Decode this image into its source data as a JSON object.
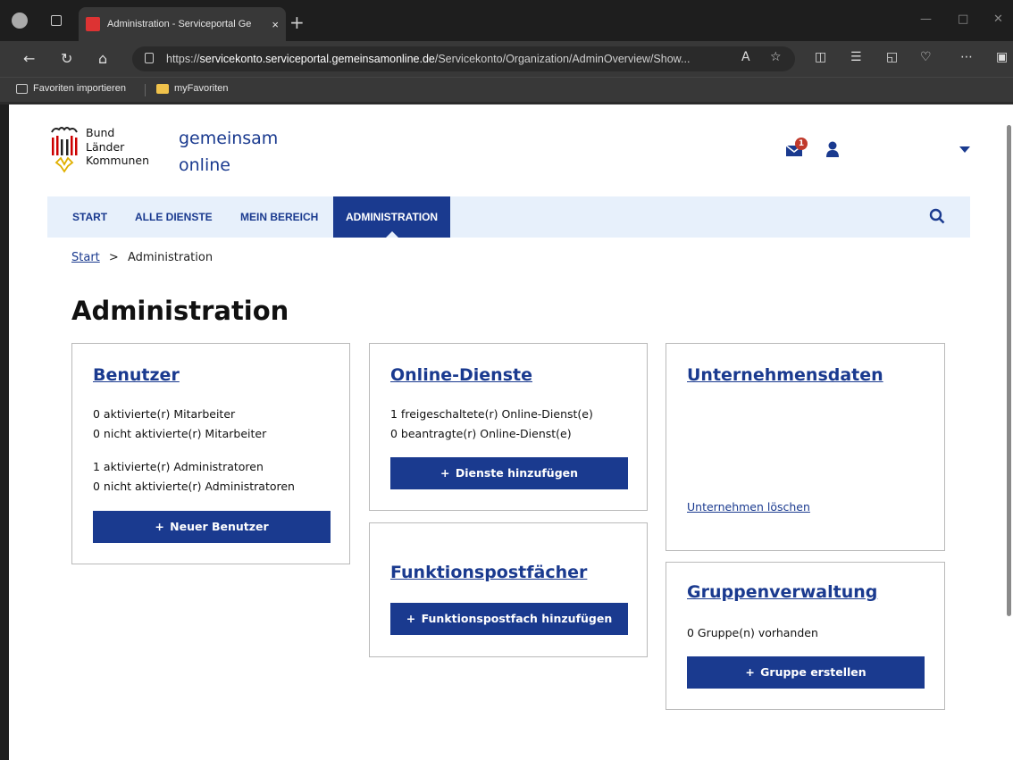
{
  "browser": {
    "tab_title": "Administration - Serviceportal Ge",
    "tab_close": "×",
    "new_tab": "+",
    "url_prefix": "https://",
    "url_host": "servicekonto.serviceportal.gemeinsamonline.de",
    "url_path": "/Servicekonto/Organization/AdminOverview/Show...",
    "favorites": [
      {
        "label": "Favoriten importieren",
        "icon": "import-icon"
      },
      {
        "label": "myFavoriten",
        "icon": "folder-icon"
      }
    ]
  },
  "logo": {
    "line1": "Bund",
    "line2": "Länder",
    "line3": "Kommunen",
    "brand_line1": "gemeinsam",
    "brand_line2": "online"
  },
  "header": {
    "mail_badge": "1"
  },
  "nav": {
    "items": [
      "START",
      "ALLE DIENSTE",
      "MEIN BEREICH",
      "ADMINISTRATION"
    ],
    "active_index": 3
  },
  "breadcrumb": {
    "start": "Start",
    "separator": ">",
    "current": "Administration"
  },
  "page_title": "Administration",
  "cards": {
    "benutzer": {
      "title": "Benutzer",
      "lines": [
        "0 aktivierte(r) Mitarbeiter",
        "0 nicht aktivierte(r) Mitarbeiter",
        "1 aktivierte(r) Administratoren",
        "0 nicht aktivierte(r) Administratoren"
      ],
      "button": "Neuer Benutzer"
    },
    "online_dienste": {
      "title": "Online-Dienste",
      "lines": [
        "1 freigeschaltete(r) Online-Dienst(e)",
        "0 beantragte(r) Online-Dienst(e)"
      ],
      "button": "Dienste hinzufügen"
    },
    "unternehmensdaten": {
      "title": "Unternehmensdaten",
      "link": "Unternehmen löschen"
    },
    "funktionspostfaecher": {
      "title": "Funktionspostfächer",
      "button": "Funktionspostfach hinzufügen"
    },
    "gruppenverwaltung": {
      "title": "Gruppenverwaltung",
      "lines": [
        "0 Gruppe(n) vorhanden"
      ],
      "button": "Gruppe erstellen"
    }
  },
  "colors": {
    "primary": "#1a3a8f",
    "nav_bg": "#e7f0fb",
    "badge": "#c0392b"
  }
}
